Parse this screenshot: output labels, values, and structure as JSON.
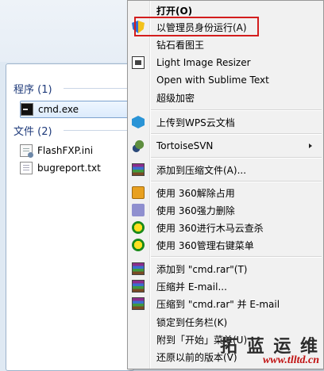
{
  "start_panel": {
    "groups": [
      {
        "title": "程序 (1)",
        "items": [
          {
            "label": "cmd.exe",
            "icon": "cmd-icon",
            "selected": true
          }
        ]
      },
      {
        "title": "文件 (2)",
        "items": [
          {
            "label": "FlashFXP.ini",
            "icon": "ini-file-icon"
          },
          {
            "label": "bugreport.txt",
            "icon": "text-file-icon"
          }
        ]
      }
    ]
  },
  "context_menu": {
    "items": [
      {
        "label": "打开(O)",
        "bold": true
      },
      {
        "label": "以管理员身份运行(A)",
        "icon": "uac-shield-icon",
        "highlighted": true
      },
      {
        "label": "钻石看图王"
      },
      {
        "label": "Light Image Resizer",
        "icon": "image-resizer-icon"
      },
      {
        "label": "Open with Sublime Text"
      },
      {
        "label": "超级加密"
      },
      {
        "label": "上传到WPS云文档",
        "icon": "wps-cloud-icon"
      },
      {
        "label": "TortoiseSVN",
        "icon": "tortoisesvn-icon",
        "submenu": true
      },
      {
        "label": "添加到压缩文件(A)...",
        "icon": "winrar-icon"
      },
      {
        "label": "使用 360解除占用",
        "icon": "360-unlock-icon"
      },
      {
        "label": "使用 360强力删除",
        "icon": "360-delete-icon"
      },
      {
        "label": "使用 360进行木马云查杀",
        "icon": "360-scan-icon"
      },
      {
        "label": "使用 360管理右键菜单",
        "icon": "360-scan-icon"
      },
      {
        "label": "添加到 \"cmd.rar\"(T)",
        "icon": "winrar-icon"
      },
      {
        "label": "压缩并 E-mail...",
        "icon": "winrar-icon"
      },
      {
        "label": "压缩到 \"cmd.rar\" 并 E-mail",
        "icon": "winrar-icon"
      },
      {
        "label": "锁定到任务栏(K)"
      },
      {
        "label": "附到「开始」菜单(U)"
      },
      {
        "label": "还原以前的版本(V)"
      }
    ]
  },
  "watermark": {
    "text": "拓 蓝 运 维",
    "url": "www.tlltd.cn"
  },
  "colors": {
    "highlight_box": "#d31d1d",
    "selection": "#dcebfc"
  }
}
